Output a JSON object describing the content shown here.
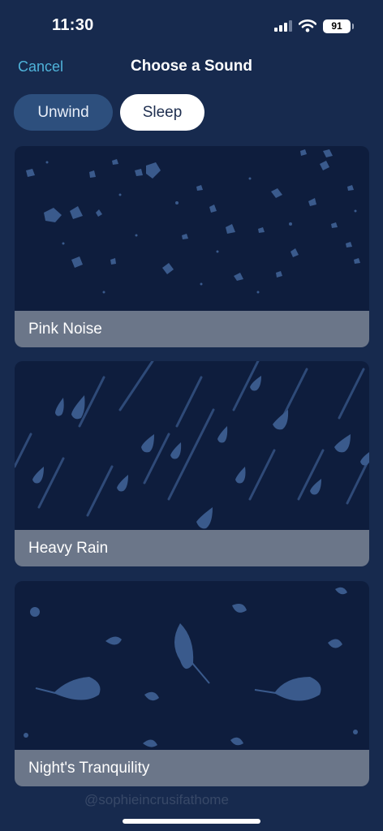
{
  "status_bar": {
    "time": "11:30",
    "battery": "91",
    "icons": [
      "signal-icon",
      "wifi-icon",
      "battery-icon"
    ]
  },
  "header": {
    "cancel_label": "Cancel",
    "title": "Choose a Sound"
  },
  "tabs": [
    {
      "label": "Unwind",
      "selected": false
    },
    {
      "label": "Sleep",
      "selected": true
    }
  ],
  "sounds": [
    {
      "title": "Pink Noise",
      "art": "speckle-pattern"
    },
    {
      "title": "Heavy Rain",
      "art": "raindrop-pattern"
    },
    {
      "title": "Night's Tranquility",
      "art": "leaf-pattern"
    }
  ],
  "watermark": "@sophieincrusifathome",
  "colors": {
    "background": "#172a4e",
    "accent": "#4fb3da",
    "card_background": "#0e1d3d",
    "card_label_background": "#6b7689",
    "tab_inactive": "#2d4f7d",
    "tab_active": "#ffffff",
    "artwork": "#3a5a8c"
  }
}
